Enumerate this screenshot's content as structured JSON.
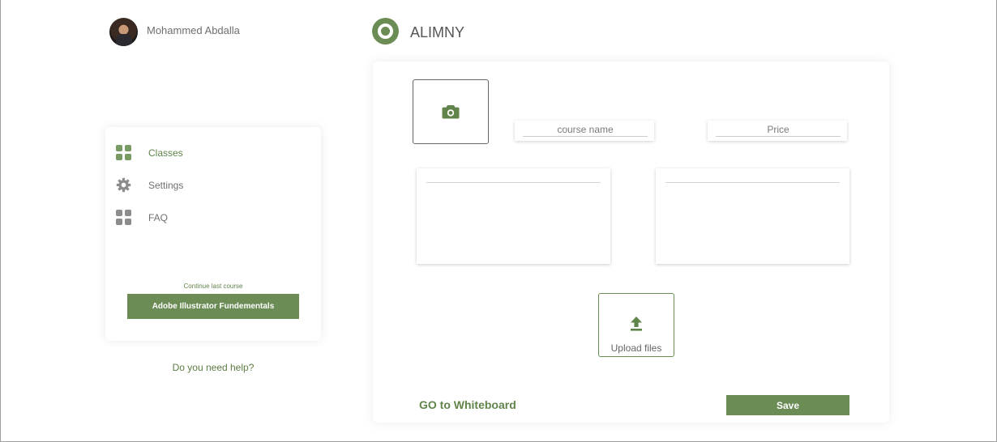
{
  "user": {
    "name": "Mohammed Abdalla"
  },
  "brand": {
    "name": "ALIMNY",
    "accent": "#6b8c55"
  },
  "sidebar": {
    "items": [
      {
        "label": "Classes",
        "icon": "grid-icon",
        "active": true
      },
      {
        "label": "Settings",
        "icon": "gear-icon",
        "active": false
      },
      {
        "label": "FAQ",
        "icon": "grid-icon",
        "active": false
      }
    ],
    "continue_label": "Continue last course",
    "last_course": "Adobe Illustrator Fundementals",
    "help_label": "Do you need help?"
  },
  "form": {
    "course_name_placeholder": "course name",
    "price_placeholder": "Price",
    "upload_label": "Upload files",
    "whiteboard_label": "GO to Whiteboard",
    "save_label": "Save"
  }
}
